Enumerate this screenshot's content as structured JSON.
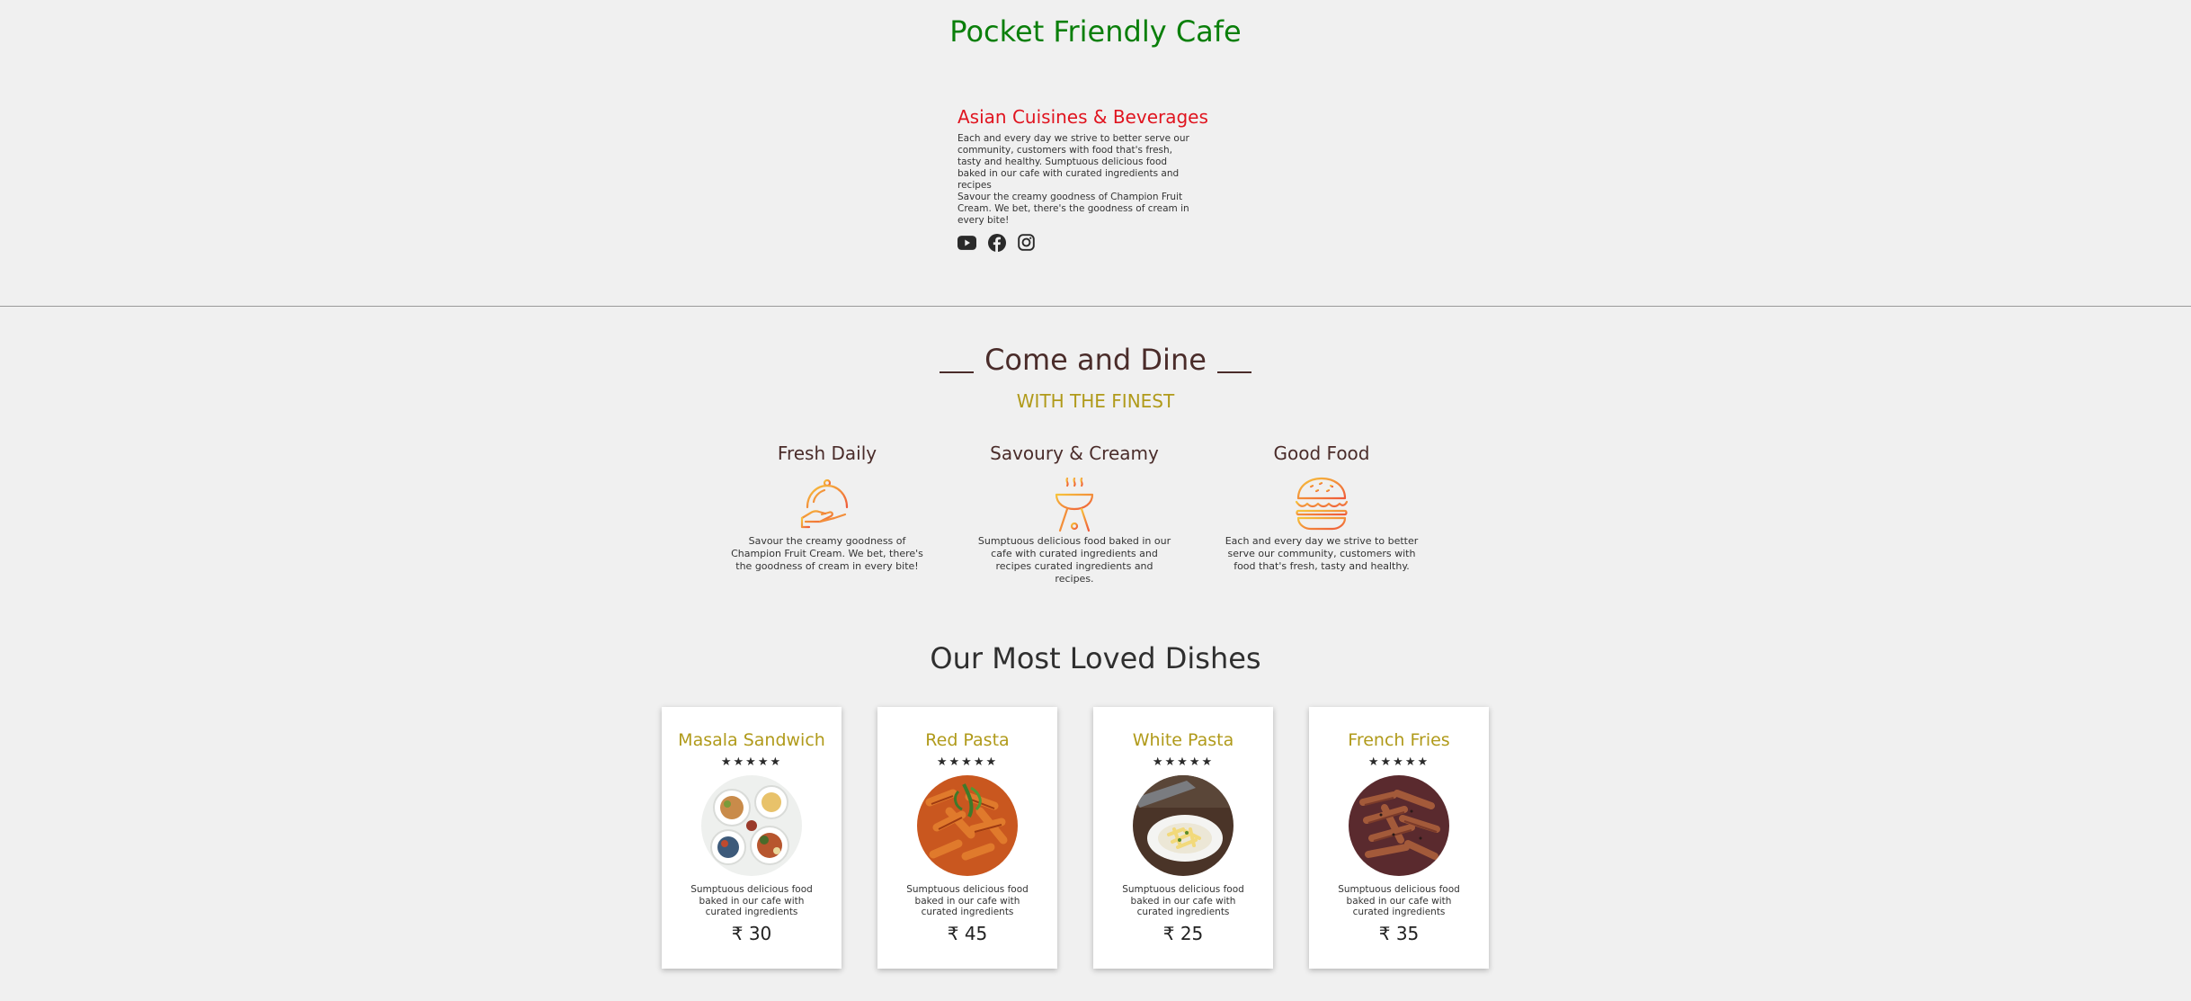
{
  "header": {
    "title": "Pocket Friendly Cafe"
  },
  "about": {
    "heading": "Asian Cuisines & Beverages",
    "paragraph1": "Each and every day we strive to better serve our community, customers with food that's fresh, tasty and healthy. Sumptuous delicious food baked in our cafe with curated ingredients and recipes",
    "paragraph2": "Savour the creamy goodness of Champion Fruit Cream. We bet, there's the goodness of cream in every bite!",
    "social_icons": [
      "youtube-icon",
      "facebook-icon",
      "instagram-icon"
    ]
  },
  "dine": {
    "title": "Come and Dine",
    "subtitle": "WITH THE FINEST",
    "features": [
      {
        "title": "Fresh Daily",
        "icon": "cloche-serving-icon",
        "text": "Savour the creamy goodness of Champion Fruit Cream. We bet, there's the goodness of cream in every bite!"
      },
      {
        "title": "Savoury & Creamy",
        "icon": "grill-icon",
        "text": "Sumptuous delicious food baked in our cafe with curated ingredients and recipes curated ingredients and recipes."
      },
      {
        "title": "Good Food",
        "icon": "burger-icon",
        "text": "Each and every day we strive to better serve our community, customers with food that's fresh, tasty and healthy."
      }
    ]
  },
  "dishes": {
    "title": "Our Most Loved Dishes",
    "items": [
      {
        "name": "Masala Sandwich",
        "stars": "★★★★★",
        "rating": 5,
        "description": "Sumptuous delicious food baked in our cafe with curated ingredients",
        "price": "₹ 30"
      },
      {
        "name": "Red Pasta",
        "stars": "★★★★★",
        "rating": 5,
        "description": "Sumptuous delicious food baked in our cafe with curated ingredients",
        "price": "₹ 45"
      },
      {
        "name": "White Pasta",
        "stars": "★★★★★",
        "rating": 5,
        "description": "Sumptuous delicious food baked in our cafe with curated ingredients",
        "price": "₹ 25"
      },
      {
        "name": "French Fries",
        "stars": "★★★★★",
        "rating": 5,
        "description": "Sumptuous delicious food baked in our cafe with curated ingredients",
        "price": "₹ 35"
      }
    ]
  },
  "colors": {
    "background": "#f0f0f0",
    "site_title": "#0a7f0a",
    "about_heading": "#e0141f",
    "accent_gold": "#b09a1a",
    "brown_heading": "#4a2c2a",
    "icon_gradient_start": "#f7c43a",
    "icon_gradient_end": "#ef5a3a"
  }
}
